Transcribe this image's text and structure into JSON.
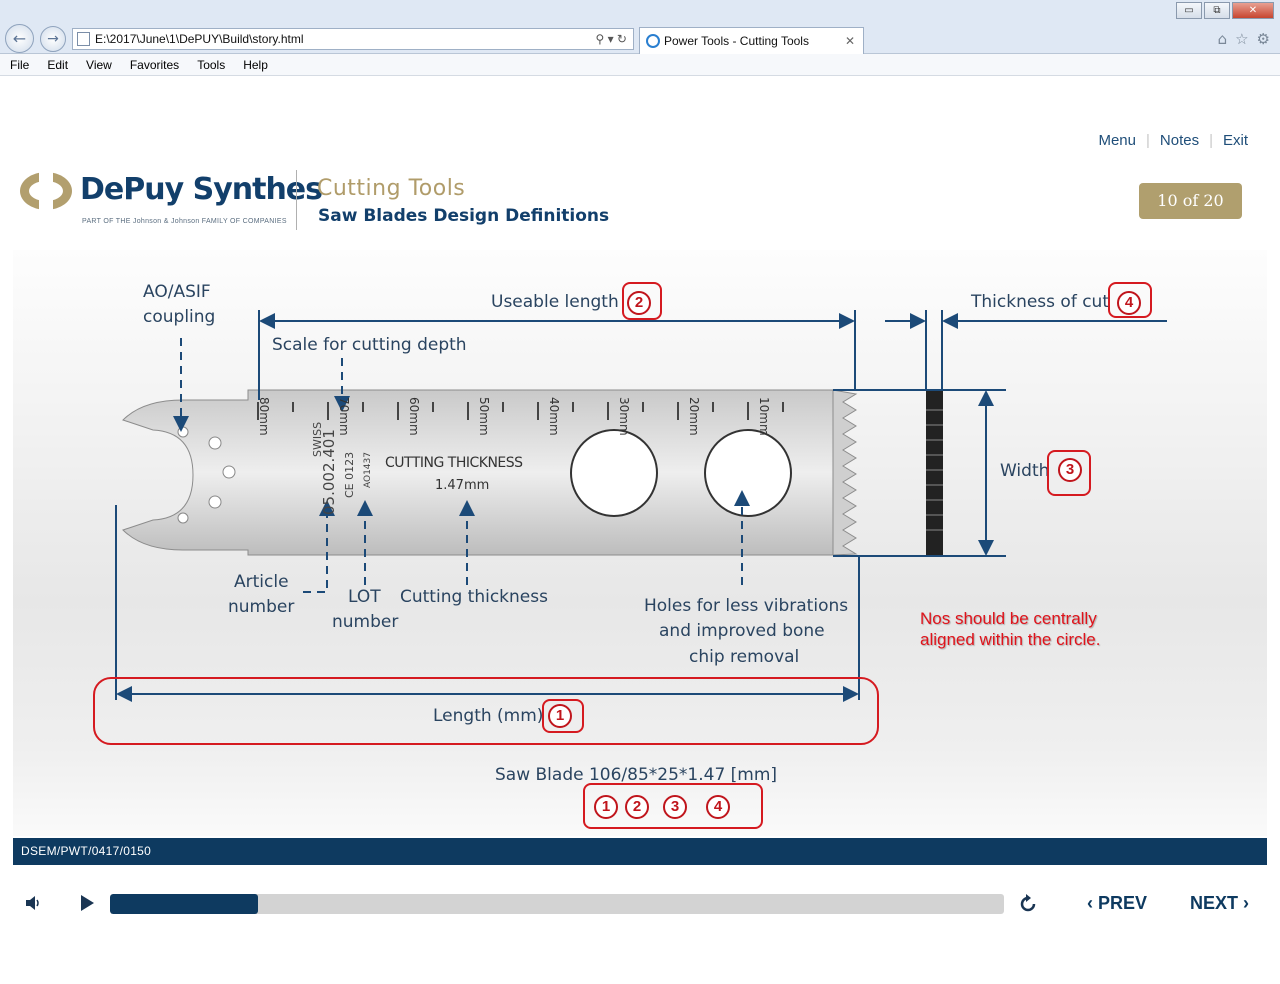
{
  "browser": {
    "address": "E:\\2017\\June\\1\\DePUY\\Build\\story.html",
    "tab_title": "Power Tools - Cutting Tools",
    "menu": [
      "File",
      "Edit",
      "View",
      "Favorites",
      "Tools",
      "Help"
    ],
    "window_controls": {
      "minimize": "▭",
      "restore": "⧉",
      "close": "✕"
    }
  },
  "header": {
    "links": {
      "menu": "Menu",
      "notes": "Notes",
      "exit": "Exit"
    },
    "brand": "DePuy Synthes",
    "brand_tagline": "PART OF THE Johnson & Johnson FAMILY OF COMPANIES",
    "course_title": "Cutting Tools",
    "slide_title": "Saw Blades Design Definitions",
    "slide_counter": "10 of 20"
  },
  "diagram": {
    "labels": {
      "coupling": "AO/ASIF",
      "coupling_2": "coupling",
      "useable_length": "Useable length",
      "scale": "Scale for cutting depth",
      "thickness_of_cut": "Thickness of cut",
      "width": "Width",
      "article_1": "Article",
      "article_2": "number",
      "lot_1": "LOT",
      "lot_2": "number",
      "cutting_thickness": "Cutting thickness",
      "holes_1": "Holes for less vibrations",
      "holes_2": "and improved bone",
      "holes_3": "chip removal",
      "length": "Length (mm)",
      "saw_blade": "Saw Blade 106/85*25*1.47 [mm]"
    },
    "blade_text": {
      "scale_marks": [
        "80mm",
        "70mm",
        "60mm",
        "50mm",
        "40mm",
        "30mm",
        "20mm",
        "10mm"
      ],
      "swiss": "SWISS",
      "article_no": "05.002.401",
      "ce": "CE 0123",
      "lot": "AO1437",
      "cutting_thickness_1": "CUTTING THICKNESS",
      "cutting_thickness_2": "1.47mm"
    },
    "markers": {
      "n1": "1",
      "n2": "2",
      "n3": "3",
      "n4": "4"
    },
    "note": [
      "Nos should be centrally",
      "aligned within the circle."
    ]
  },
  "footer": {
    "code": "DSEM/PWT/0417/0150"
  },
  "player": {
    "progress": 0.165,
    "prev": "PREV",
    "next": "NEXT"
  }
}
